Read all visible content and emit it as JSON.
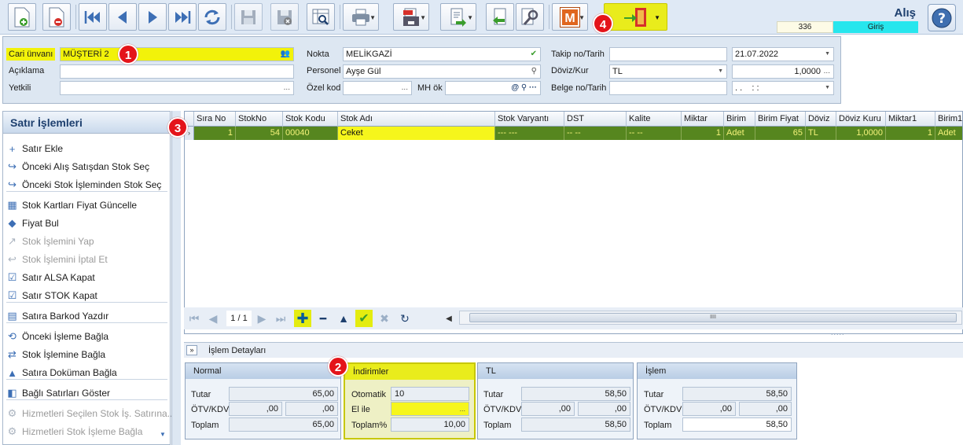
{
  "window": {
    "title": "Alış",
    "document_no": "336",
    "document_type": "Giriş"
  },
  "toolbar": {
    "buttons": [
      "new-doc-icon",
      "delete-doc-icon",
      "first-record-icon",
      "prev-record-icon",
      "next-record-icon",
      "last-record-icon",
      "refresh-icon",
      "save-icon",
      "cancel-save-icon",
      "preview-icon",
      "print-icon",
      "pdf-icon",
      "export-icon",
      "back-icon",
      "tools-icon",
      "m-app-icon",
      "exit-icon"
    ]
  },
  "header": {
    "labels": {
      "cari_unvani": "Cari ünvanı",
      "aciklama": "Açıklama",
      "yetkili": "Yetkili",
      "nokta": "Nokta",
      "personel": "Personel",
      "ozel_kod": "Özel kod",
      "mh_ok": "MH ök",
      "takip_no": "Takip no/Tarih",
      "doviz_kur": "Döviz/Kur",
      "belge_no": "Belge no/Tarih"
    },
    "values": {
      "cari_unvani": "MÜŞTERİ 2",
      "aciklama": "",
      "yetkili": "",
      "nokta": "MELİKGAZİ",
      "personel": "Ayşe Gül",
      "ozel_kod": "",
      "mh_ok": "",
      "takip_no": "",
      "tarih": "21.07.2022",
      "doviz": "TL",
      "kur": "1,0000",
      "belge_no": "",
      "belge_tarih": ". .    : :"
    },
    "ellipsis": "..."
  },
  "side_panel": {
    "title": "Satır İşlemleri",
    "items": [
      {
        "label": "Satır Ekle",
        "icon": "+",
        "enabled": true
      },
      {
        "label": "Önceki Alış Satışdan Stok Seç",
        "icon": "↪",
        "enabled": true
      },
      {
        "label": "Önceki Stok İşleminden Stok Seç",
        "icon": "↪",
        "enabled": true
      },
      {
        "label": "Stok Kartları Fiyat Güncelle",
        "icon": "▦",
        "enabled": true
      },
      {
        "label": "Fiyat Bul",
        "icon": "◆",
        "enabled": true
      },
      {
        "label": "Stok İşlemini Yap",
        "icon": "↗",
        "enabled": false
      },
      {
        "label": "Stok İşlemini İptal Et",
        "icon": "↩",
        "enabled": false
      },
      {
        "label": "Satır ALSA Kapat",
        "icon": "☑",
        "enabled": true
      },
      {
        "label": "Satır STOK Kapat",
        "icon": "☑",
        "enabled": true
      },
      {
        "label": "Satıra Barkod Yazdır",
        "icon": "▤",
        "enabled": true
      },
      {
        "label": "Önceki İşleme Bağla",
        "icon": "⟲",
        "enabled": true
      },
      {
        "label": "Stok İşlemine Bağla",
        "icon": "⇄",
        "enabled": true
      },
      {
        "label": "Satıra Doküman Bağla",
        "icon": "▲",
        "enabled": true
      },
      {
        "label": "Bağlı Satırları Göster",
        "icon": "◧",
        "enabled": true
      },
      {
        "label": "Hizmetleri Seçilen Stok İş. Satırına...",
        "icon": "⚙",
        "enabled": false
      },
      {
        "label": "Hizmetleri Stok İşleme Bağla",
        "icon": "⚙",
        "enabled": false
      }
    ]
  },
  "grid": {
    "columns": [
      "Sıra No",
      "StokNo",
      "Stok Kodu",
      "Stok Adı",
      "Stok Varyantı",
      "DST",
      "Kalite",
      "Miktar",
      "Birim",
      "Birim Fiyat",
      "Döviz",
      "Döviz Kuru",
      "Miktar1",
      "Birim1"
    ],
    "rows": [
      [
        "1",
        "54",
        "00040",
        "Ceket",
        "--- ---",
        "-- --",
        "-- --",
        "1",
        "Adet",
        "65",
        "TL",
        "1,0000",
        "1",
        "Adet"
      ]
    ],
    "navigator": {
      "position": "1 / 1",
      "scroll_grip": "IIII",
      "grip": "....."
    }
  },
  "details": {
    "title": "İşlem Detayları",
    "normal": {
      "title": "Normal",
      "tutar_label": "Tutar",
      "tutar": "65,00",
      "otv_label": "ÖTV/KDV",
      "otv": ",00",
      "kdv": ",00",
      "toplam_label": "Toplam",
      "toplam": "65,00"
    },
    "indirimler": {
      "title": "İndirimler",
      "otomatik_label": "Otomatik",
      "otomatik": "10",
      "elile_label": "El ile",
      "elile": "",
      "toplam_label": "Toplam%",
      "toplam": "10,00"
    },
    "tl": {
      "title": "TL",
      "tutar_label": "Tutar",
      "tutar": "58,50",
      "otv_label": "ÖTV/KDV",
      "otv": ",00",
      "kdv": ",00",
      "toplam_label": "Toplam",
      "toplam": "58,50"
    },
    "islem": {
      "title": "İşlem",
      "tutar_label": "Tutar",
      "tutar": "58,50",
      "otv_label": "ÖTV/KDV",
      "otv": ",00",
      "kdv": ",00",
      "toplam_label": "Toplam",
      "toplam": "58,50"
    }
  },
  "markers": [
    "1",
    "2",
    "3",
    "4"
  ],
  "colors": {
    "highlight": "#f2f20a",
    "row_selected": "#56861f",
    "doc_type_bg": "#27e6ed",
    "marker": "#e4141a"
  }
}
